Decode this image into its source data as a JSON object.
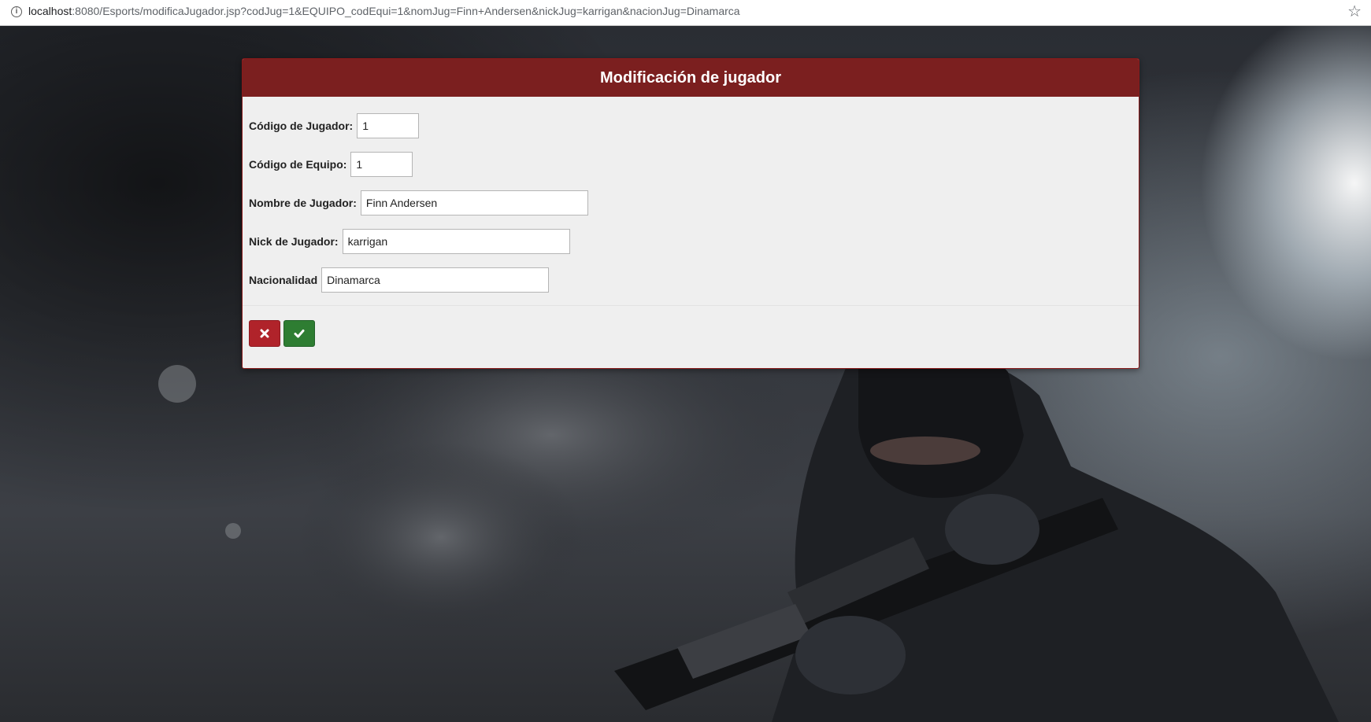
{
  "browser": {
    "url_host": "localhost",
    "url_rest": ":8080/Esports/modificaJugador.jsp?codJug=1&EQUIPO_codEqui=1&nomJug=Finn+Andersen&nickJug=karrigan&nacionJug=Dinamarca",
    "info_icon": "info-icon",
    "star_icon": "bookmark-star-icon"
  },
  "panel": {
    "title": "Modificación de jugador",
    "fields": [
      {
        "label": "Código de Jugador:",
        "value": "1"
      },
      {
        "label": "Código de Equipo:",
        "value": "1"
      },
      {
        "label": "Nombre de Jugador:",
        "value": "Finn Andersen"
      },
      {
        "label": "Nick de Jugador:",
        "value": "karrigan"
      },
      {
        "label": "Nacionalidad",
        "value": "Dinamarca"
      }
    ],
    "buttons": {
      "cancel_icon": "close-icon",
      "confirm_icon": "check-icon"
    }
  },
  "colors": {
    "header": "#7b1f1f",
    "cancel": "#b0232a",
    "confirm": "#2e7d32"
  }
}
